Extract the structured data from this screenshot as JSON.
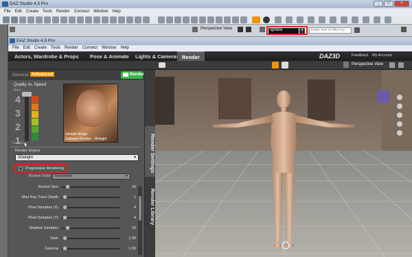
{
  "outer": {
    "title": "DAZ Studio 4.5 Pro",
    "menu": [
      "File",
      "Edit",
      "Create",
      "Tools",
      "Render",
      "Connect",
      "Window",
      "Help"
    ],
    "viewport_label": "Perspective View",
    "search_value": "sphere",
    "filter_placeholder": "Enter text to filter by..."
  },
  "inner": {
    "title": "DAZ Studio 4.5 Pro",
    "menu": [
      "File",
      "Edit",
      "Create",
      "Tools",
      "Render",
      "Connect",
      "Window",
      "Help"
    ],
    "tabs": [
      "Actors, Wardrobe & Props",
      "Pose & Animate",
      "Lights & Cameras",
      "Render"
    ],
    "brand": "DAZ3D",
    "links": [
      "Feedback",
      "My Account"
    ],
    "viewport_label": "Perspective View"
  },
  "render": {
    "subtabs": [
      "General",
      "Advanced"
    ],
    "render_button": "Render",
    "quality_label": "Quality vs. Speed",
    "quality_levels": [
      "4",
      "3",
      "2",
      "1"
    ],
    "best_label": "Best",
    "fast_label": "Fastest",
    "preview_caption_1": "Sample Image",
    "preview_caption_2": "Software Render - 3Delight",
    "engine_label": "Render Engine",
    "engine_value": "3Delight",
    "progressive_label": "Progressive Rendering",
    "bucket_order_label": "Bucket Order",
    "bucket_order_value": "Horizontal",
    "settings": [
      {
        "label": "Bucket Size",
        "value": "16",
        "level": 0.1
      },
      {
        "label": "Max Ray Trace Depth",
        "value": "1",
        "level": 0.05
      },
      {
        "label": "Pixel Samples (X)",
        "value": "4",
        "level": 0.05
      },
      {
        "label": "Pixel Samples (Y)",
        "value": "4",
        "level": 0.05
      },
      {
        "label": "Shadow Samples",
        "value": "16",
        "level": 0.1
      },
      {
        "label": "Gain",
        "value": "1.00",
        "level": 0.05
      },
      {
        "label": "Gamma",
        "value": "1.00",
        "level": 0.05
      }
    ]
  },
  "vtabs": [
    "Render Settings",
    "Render Library"
  ],
  "colors": {
    "accent": "#f29400",
    "render_green": "#3bb54a",
    "highlight": "#e02020"
  }
}
